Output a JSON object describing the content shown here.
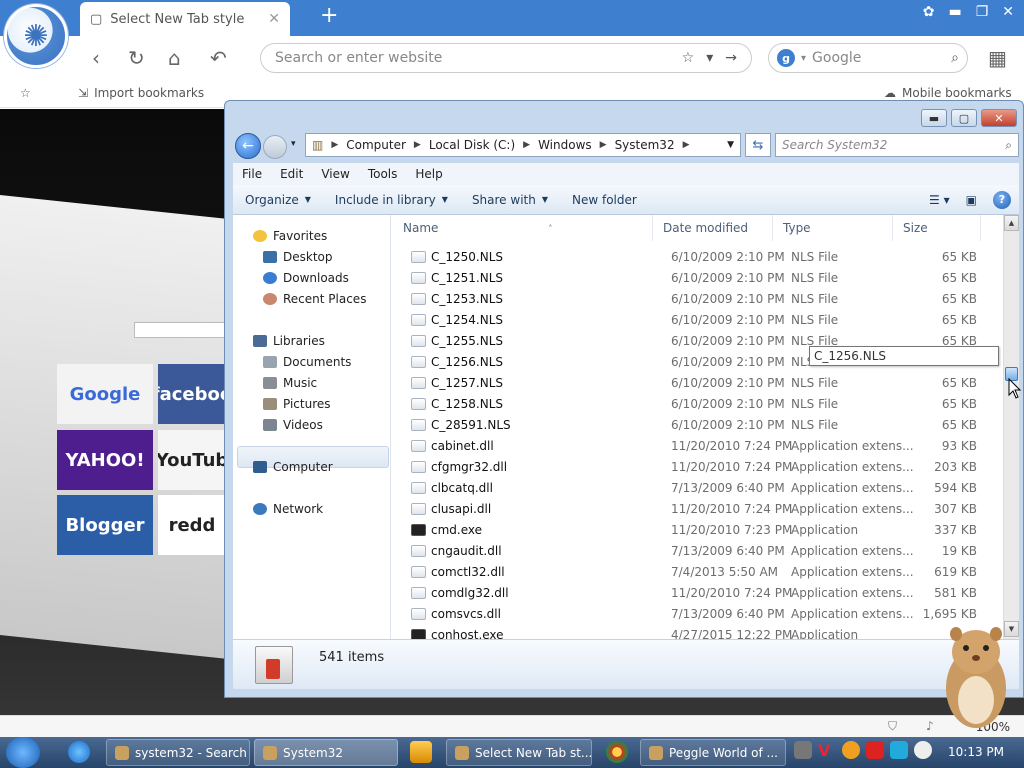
{
  "browser": {
    "tab_title": "Select New Tab style",
    "address_placeholder": "Search or enter website",
    "search_engine": "Google",
    "bookmarks": {
      "import": "Import bookmarks",
      "mobile": "Mobile bookmarks"
    },
    "zoom": "100%"
  },
  "new_tab_tiles": [
    {
      "label": "Google",
      "color": "#f3f3f3",
      "text_color": "#3b6ad8"
    },
    {
      "label": "faceboo",
      "color": "#3b5998",
      "text_color": "#ffffff"
    },
    {
      "label": "YAHOO!",
      "color": "#4e1e8e",
      "text_color": "#ffffff"
    },
    {
      "label": "YouTub",
      "color": "#f5f5f5",
      "text_color": "#222222"
    },
    {
      "label": "Blogger",
      "color": "#2c5ea8",
      "text_color": "#ffffff"
    },
    {
      "label": "redd",
      "color": "#ffffff",
      "text_color": "#222222"
    }
  ],
  "explorer": {
    "breadcrumb": [
      "Computer",
      "Local Disk (C:)",
      "Windows",
      "System32"
    ],
    "search_placeholder": "Search System32",
    "menu": [
      "File",
      "Edit",
      "View",
      "Tools",
      "Help"
    ],
    "commands": [
      "Organize",
      "Include in library",
      "Share with",
      "New folder"
    ],
    "nav": {
      "favorites": "Favorites",
      "desktop": "Desktop",
      "downloads": "Downloads",
      "recent_places": "Recent Places",
      "libraries": "Libraries",
      "documents": "Documents",
      "music": "Music",
      "pictures": "Pictures",
      "videos": "Videos",
      "computer": "Computer",
      "network": "Network"
    },
    "columns": {
      "name": "Name",
      "date": "Date modified",
      "type": "Type",
      "size": "Size"
    },
    "tooltip": "C_1256.NLS",
    "files": [
      {
        "name": "C_1250.NLS",
        "date": "6/10/2009 2:10 PM",
        "type": "NLS File",
        "size": "65 KB",
        "icon": "file"
      },
      {
        "name": "C_1251.NLS",
        "date": "6/10/2009 2:10 PM",
        "type": "NLS File",
        "size": "65 KB",
        "icon": "file"
      },
      {
        "name": "C_1253.NLS",
        "date": "6/10/2009 2:10 PM",
        "type": "NLS File",
        "size": "65 KB",
        "icon": "file"
      },
      {
        "name": "C_1254.NLS",
        "date": "6/10/2009 2:10 PM",
        "type": "NLS File",
        "size": "65 KB",
        "icon": "file"
      },
      {
        "name": "C_1255.NLS",
        "date": "6/10/2009 2:10 PM",
        "type": "NLS File",
        "size": "65 KB",
        "icon": "file"
      },
      {
        "name": "C_1256.NLS",
        "date": "6/10/2009 2:10 PM",
        "type": "NLS File",
        "size": "65 KB",
        "icon": "file"
      },
      {
        "name": "C_1257.NLS",
        "date": "6/10/2009 2:10 PM",
        "type": "NLS File",
        "size": "65 KB",
        "icon": "file"
      },
      {
        "name": "C_1258.NLS",
        "date": "6/10/2009 2:10 PM",
        "type": "NLS File",
        "size": "65 KB",
        "icon": "file"
      },
      {
        "name": "C_28591.NLS",
        "date": "6/10/2009 2:10 PM",
        "type": "NLS File",
        "size": "65 KB",
        "icon": "file"
      },
      {
        "name": "cabinet.dll",
        "date": "11/20/2010 7:24 PM",
        "type": "Application extens...",
        "size": "93 KB",
        "icon": "file"
      },
      {
        "name": "cfgmgr32.dll",
        "date": "11/20/2010 7:24 PM",
        "type": "Application extens...",
        "size": "203 KB",
        "icon": "file"
      },
      {
        "name": "clbcatq.dll",
        "date": "7/13/2009 6:40 PM",
        "type": "Application extens...",
        "size": "594 KB",
        "icon": "file"
      },
      {
        "name": "clusapi.dll",
        "date": "11/20/2010 7:24 PM",
        "type": "Application extens...",
        "size": "307 KB",
        "icon": "file"
      },
      {
        "name": "cmd.exe",
        "date": "11/20/2010 7:23 PM",
        "type": "Application",
        "size": "337 KB",
        "icon": "exe"
      },
      {
        "name": "cngaudit.dll",
        "date": "7/13/2009 6:40 PM",
        "type": "Application extens...",
        "size": "19 KB",
        "icon": "file"
      },
      {
        "name": "comctl32.dll",
        "date": "7/4/2013 5:50 AM",
        "type": "Application extens...",
        "size": "619 KB",
        "icon": "file"
      },
      {
        "name": "comdlg32.dll",
        "date": "11/20/2010 7:24 PM",
        "type": "Application extens...",
        "size": "581 KB",
        "icon": "file"
      },
      {
        "name": "comsvcs.dll",
        "date": "7/13/2009 6:40 PM",
        "type": "Application extens...",
        "size": "1,695 KB",
        "icon": "file"
      },
      {
        "name": "conhost.exe",
        "date": "4/27/2015 12:22 PM",
        "type": "Application",
        "size": "",
        "icon": "exe"
      }
    ],
    "item_count": "541 items"
  },
  "taskbar": {
    "buttons": [
      {
        "label": "system32 - Search ...",
        "active": false
      },
      {
        "label": "System32",
        "active": true
      },
      {
        "label": "Select New Tab st...",
        "active": false
      },
      {
        "label": "Peggle World of ...",
        "active": false
      }
    ],
    "clock": "10:13 PM"
  },
  "colors": {
    "browser_accent": "#3e7fcf",
    "explorer_frame": "#c5d8ee",
    "taskbar": "#274469"
  }
}
